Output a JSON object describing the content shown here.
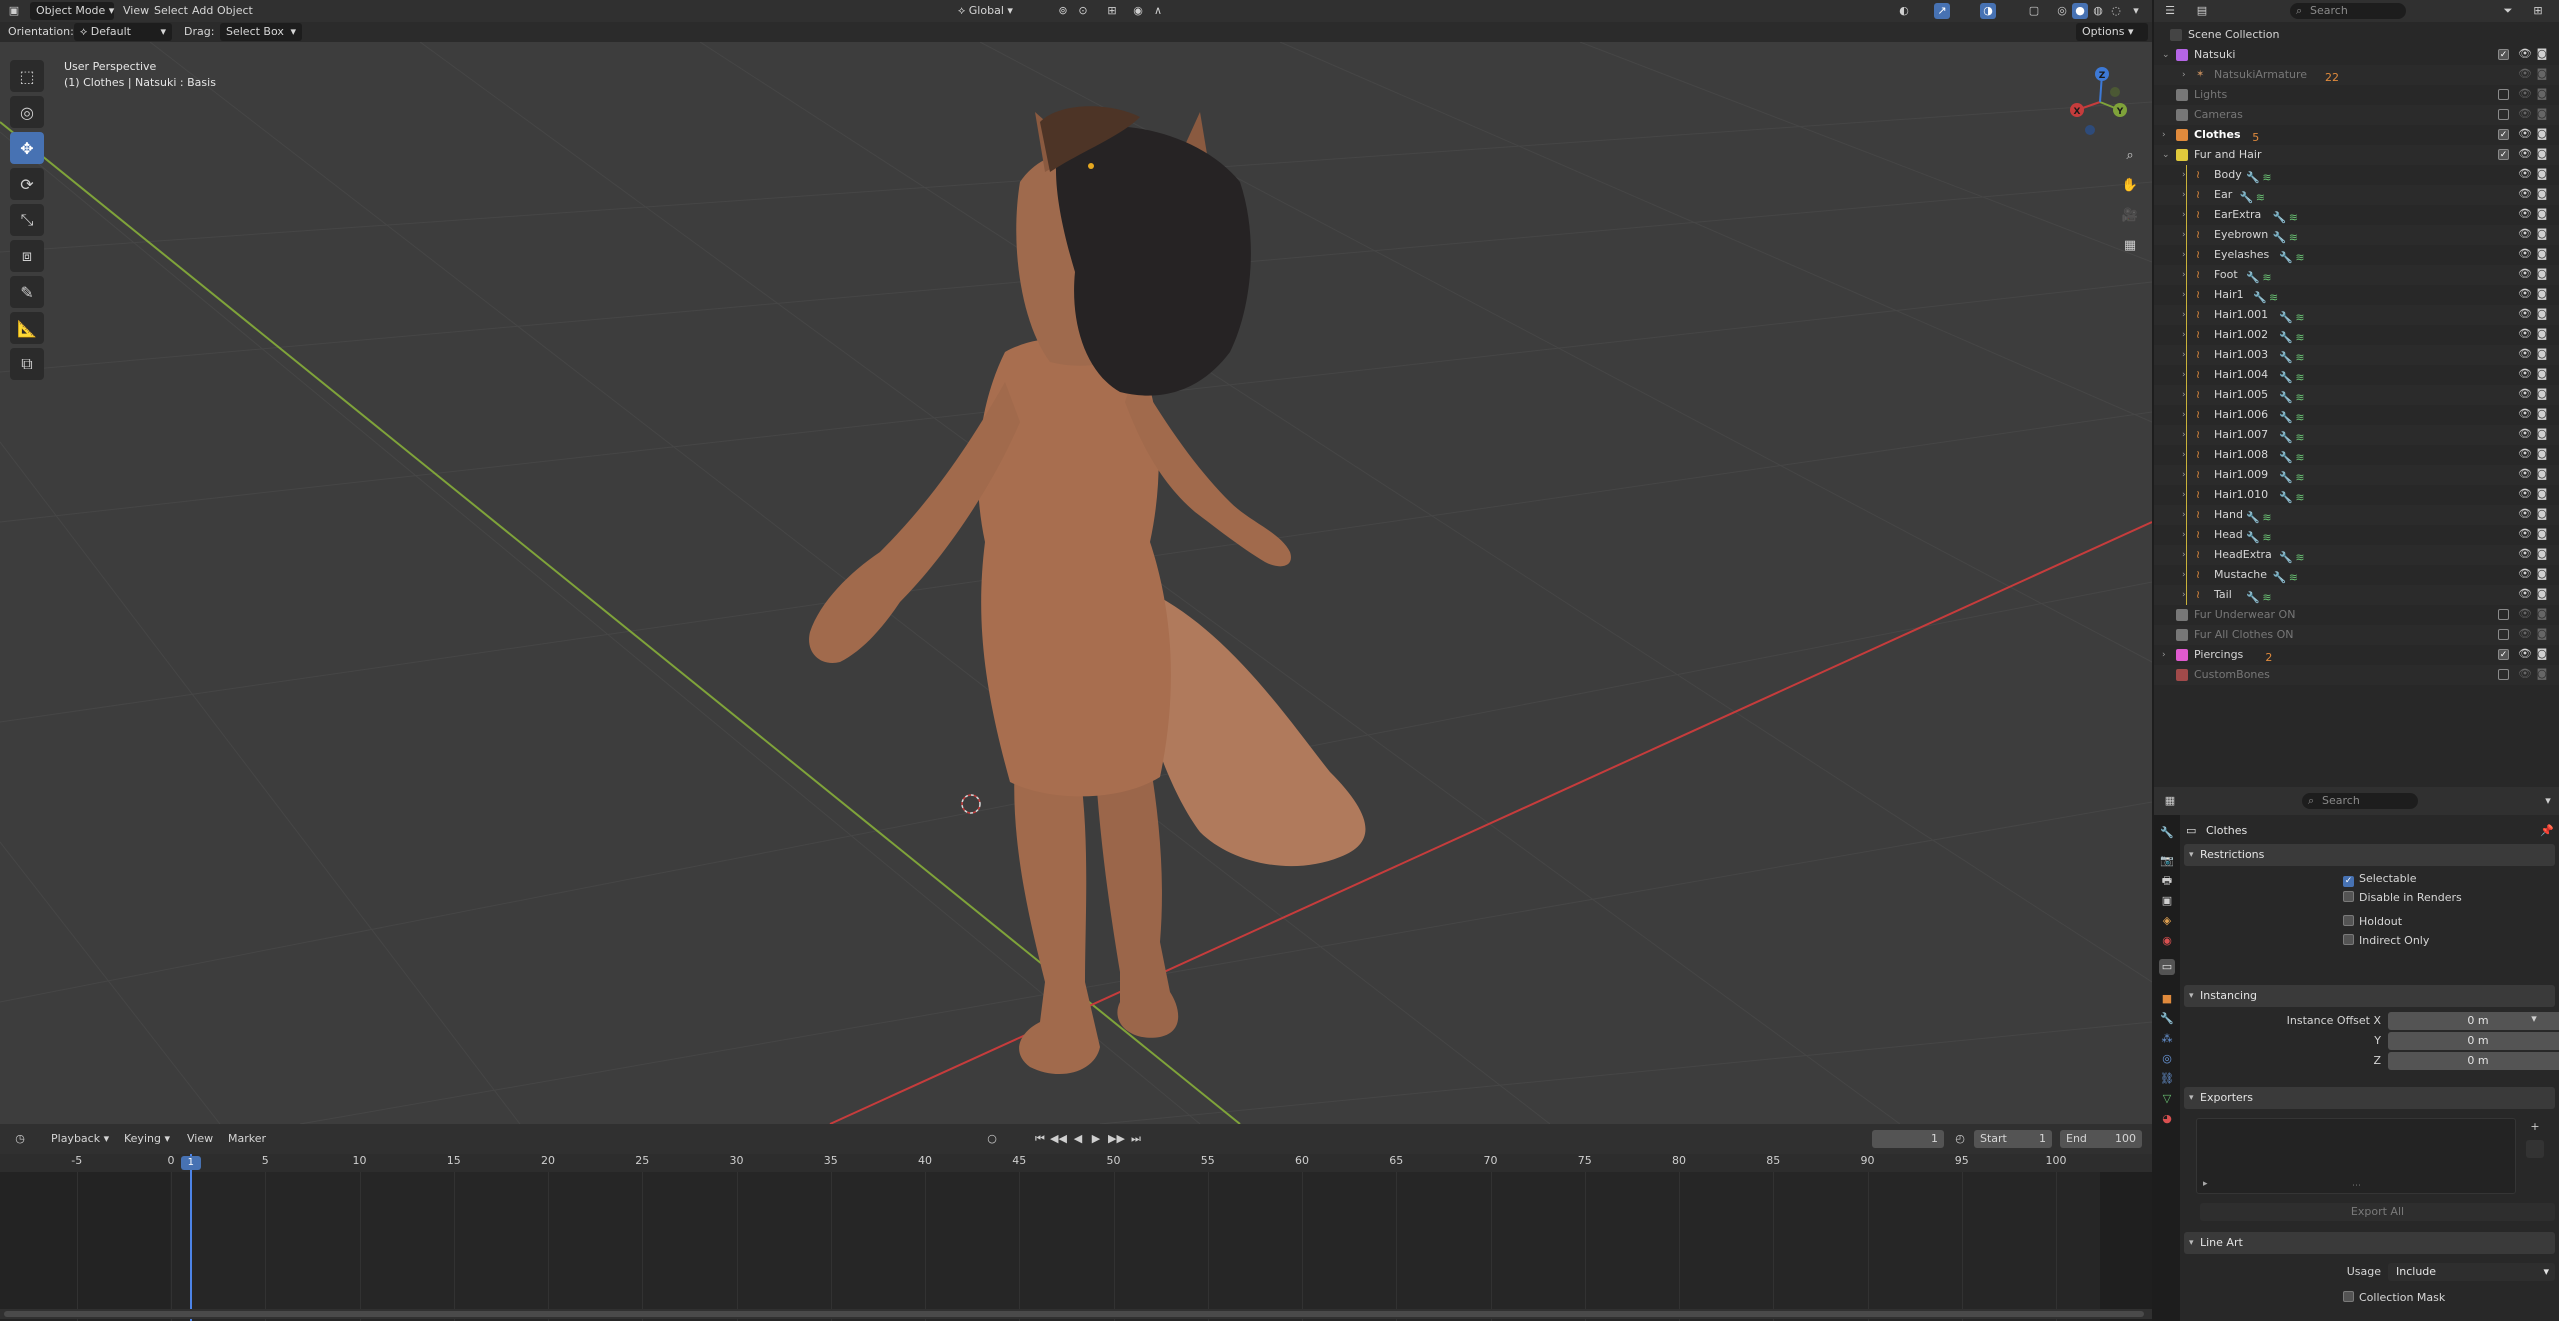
{
  "header": {
    "editor_type_icon": "cube-icon",
    "mode": "Object Mode",
    "menus": [
      "View",
      "Select",
      "Add",
      "Object"
    ],
    "transform_orientation": "Global",
    "search_placeholder": "Search"
  },
  "tool_header": {
    "orientation_label": "Orientation:",
    "orientation_value": "Default",
    "drag_label": "Drag:",
    "drag_value": "Select Box",
    "options": "Options"
  },
  "viewport": {
    "info_line1": "User Perspective",
    "info_line2": "(1) Clothes | Natsuki : Basis",
    "gizmo": {
      "x": "X",
      "y": "Y",
      "z": "Z"
    }
  },
  "outliner": {
    "root": "Scene Collection",
    "rows": [
      {
        "label": "Natsuki",
        "kind": "collection",
        "color": "#b565e6",
        "depth": 0,
        "expanded": true,
        "check": true
      },
      {
        "label": "NatsukiArmature",
        "kind": "armature",
        "color": "#c08a5b",
        "depth": 1,
        "dim": true,
        "badge": "22"
      },
      {
        "label": "Lights",
        "kind": "collection",
        "color": "#777777",
        "depth": 0,
        "dim": true,
        "check": false
      },
      {
        "label": "Cameras",
        "kind": "collection",
        "color": "#777777",
        "depth": 0,
        "dim": true,
        "check": false
      },
      {
        "label": "Clothes",
        "kind": "collection",
        "color": "#e08a3c",
        "depth": 0,
        "bold": true,
        "check": true,
        "badge": "5"
      },
      {
        "label": "Fur and Hair",
        "kind": "collection",
        "color": "#e0c93c",
        "depth": 0,
        "expanded": true,
        "check": true
      },
      {
        "label": "Body",
        "kind": "hair",
        "depth": 1
      },
      {
        "label": "Ear",
        "kind": "hair",
        "depth": 1
      },
      {
        "label": "EarExtra",
        "kind": "hair",
        "depth": 1
      },
      {
        "label": "Eyebrown",
        "kind": "hair",
        "depth": 1
      },
      {
        "label": "Eyelashes",
        "kind": "hair",
        "depth": 1
      },
      {
        "label": "Foot",
        "kind": "hair",
        "depth": 1
      },
      {
        "label": "Hair1",
        "kind": "hair",
        "depth": 1
      },
      {
        "label": "Hair1.001",
        "kind": "hair",
        "depth": 1
      },
      {
        "label": "Hair1.002",
        "kind": "hair",
        "depth": 1
      },
      {
        "label": "Hair1.003",
        "kind": "hair",
        "depth": 1
      },
      {
        "label": "Hair1.004",
        "kind": "hair",
        "depth": 1
      },
      {
        "label": "Hair1.005",
        "kind": "hair",
        "depth": 1
      },
      {
        "label": "Hair1.006",
        "kind": "hair",
        "depth": 1
      },
      {
        "label": "Hair1.007",
        "kind": "hair",
        "depth": 1
      },
      {
        "label": "Hair1.008",
        "kind": "hair",
        "depth": 1
      },
      {
        "label": "Hair1.009",
        "kind": "hair",
        "depth": 1
      },
      {
        "label": "Hair1.010",
        "kind": "hair",
        "depth": 1
      },
      {
        "label": "Hand",
        "kind": "hair",
        "depth": 1
      },
      {
        "label": "Head",
        "kind": "hair",
        "depth": 1
      },
      {
        "label": "HeadExtra",
        "kind": "hair",
        "depth": 1
      },
      {
        "label": "Mustache",
        "kind": "hair",
        "depth": 1
      },
      {
        "label": "Tail",
        "kind": "hair",
        "depth": 1
      },
      {
        "label": "Fur Underwear ON",
        "kind": "collection",
        "color": "#777777",
        "depth": 0,
        "dim": true,
        "check": false
      },
      {
        "label": "Fur All Clothes ON",
        "kind": "collection",
        "color": "#777777",
        "depth": 0,
        "dim": true,
        "check": false
      },
      {
        "label": "Piercings",
        "kind": "collection",
        "color": "#e05acf",
        "depth": 0,
        "check": true,
        "badge": "2"
      },
      {
        "label": "CustomBones",
        "kind": "collection",
        "color": "#a14a4a",
        "depth": 0,
        "dim": true,
        "check": false
      }
    ]
  },
  "properties": {
    "search_placeholder": "Search",
    "object_name": "Clothes",
    "panels": {
      "restrictions": "Restrictions",
      "instancing": "Instancing",
      "exporters": "Exporters",
      "line_art": "Line Art"
    },
    "restrictions": [
      {
        "label": "Selectable",
        "checked": true
      },
      {
        "label": "Disable in Renders",
        "checked": false
      },
      {
        "label": "Holdout",
        "checked": false
      },
      {
        "label": "Indirect Only",
        "checked": false
      }
    ],
    "instancing": {
      "offset_x_label": "Instance Offset X",
      "offset_x": "0 m",
      "offset_y_label": "Y",
      "offset_y": "0 m",
      "offset_z_label": "Z",
      "offset_z": "0 m"
    },
    "export_all": "Export All",
    "line_art": {
      "usage_label": "Usage",
      "usage_value": "Include",
      "collection_mask": "Collection Mask"
    }
  },
  "timeline": {
    "menus": [
      "Playback",
      "Keying",
      "View",
      "Marker"
    ],
    "current_frame": "1",
    "start_label": "Start",
    "start": "1",
    "end_label": "End",
    "end": "100",
    "ruler": [
      "-5",
      "0",
      "1",
      "5",
      "10",
      "15",
      "20",
      "25",
      "30",
      "35",
      "40",
      "45",
      "50",
      "55",
      "60",
      "65",
      "70",
      "75",
      "80",
      "85",
      "90",
      "95",
      "100"
    ]
  },
  "colors": {
    "accent": "#4772b3",
    "x_axis": "#c63c3c",
    "y_axis": "#7fa33a",
    "z_axis": "#3d79d6",
    "fur": "#a86e4f"
  }
}
